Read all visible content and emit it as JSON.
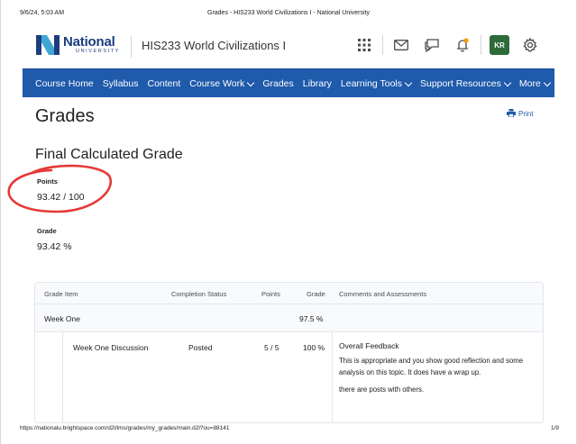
{
  "print_header": {
    "date": "9/6/24, 5:03 AM",
    "title": "Grades - HIS233 World Civilizations I - National University"
  },
  "logo": {
    "name": "National",
    "sub": "UNIVERSITY",
    "color": "#1c3e80"
  },
  "course_title": "HIS233 World Civilizations I",
  "user": {
    "initials": "KR",
    "avatar_color": "#2e6b3a"
  },
  "toolbar_icons": [
    "app-grid-icon",
    "mail-icon",
    "chat-icon",
    "bell-icon",
    "gear-icon"
  ],
  "nav": {
    "color": "#1f5aab",
    "items": [
      {
        "label": "Course Home",
        "dropdown": false
      },
      {
        "label": "Syllabus",
        "dropdown": false
      },
      {
        "label": "Content",
        "dropdown": false
      },
      {
        "label": "Course Work",
        "dropdown": true
      },
      {
        "label": "Grades",
        "dropdown": false
      },
      {
        "label": "Library",
        "dropdown": false
      },
      {
        "label": "Learning Tools",
        "dropdown": true
      },
      {
        "label": "Support Resources",
        "dropdown": true
      },
      {
        "label": "More",
        "dropdown": true
      }
    ]
  },
  "page": {
    "title": "Grades",
    "print_label": "Print",
    "section_title": "Final Calculated Grade",
    "points_label": "Points",
    "points_value": "93.42 / 100",
    "grade_label": "Grade",
    "grade_value": "93.42 %",
    "annotation_color": "#e53935"
  },
  "table": {
    "headers": {
      "item": "Grade Item",
      "status": "Completion Status",
      "points": "Points",
      "grade": "Grade",
      "comments": "Comments and Assessments"
    },
    "category": {
      "name": "Week One",
      "grade": "97.5 %"
    },
    "item": {
      "name": "Week One Discussion",
      "status": "Posted",
      "points": "5 / 5",
      "grade": "100 %",
      "feedback_title": "Overall Feedback",
      "feedback_text": "This is appropriate and you show good reflection and some analysis on this topic.  It does have a wrap up.",
      "feedback_text2": "there are posts with others."
    }
  },
  "print_footer": {
    "url": "https://nationalu.brightspace.com/d2l/lms/grades/my_grades/main.d2l?ou=88141",
    "page": "1/9"
  }
}
